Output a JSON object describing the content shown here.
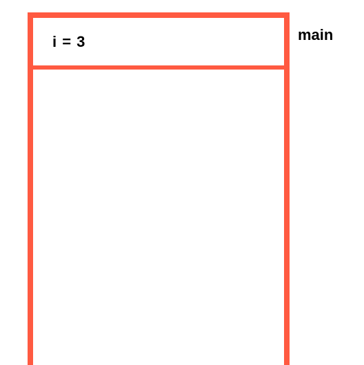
{
  "stack": {
    "frames": [
      {
        "content": "i = 3",
        "label": "main"
      }
    ]
  }
}
